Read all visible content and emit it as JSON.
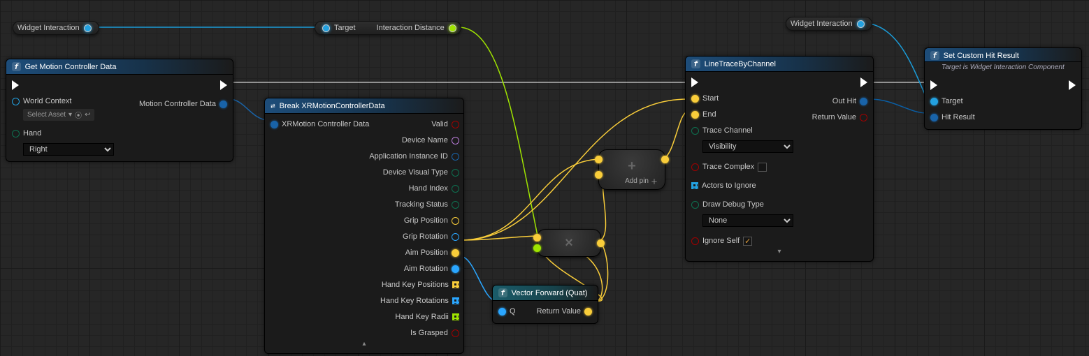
{
  "chips": {
    "widget_interaction_a": "Widget Interaction",
    "widget_interaction_b": "Widget Interaction",
    "target": "Target",
    "interaction_distance": "Interaction Distance"
  },
  "n_gmcd": {
    "title": "Get Motion Controller Data",
    "in": {
      "world_context": "World Context",
      "select_asset": "Select Asset",
      "hand": "Hand",
      "hand_value": "Right"
    },
    "out": {
      "mcd": "Motion Controller Data"
    }
  },
  "n_break": {
    "title": "Break XRMotionControllerData",
    "in": "XRMotion Controller Data",
    "out": {
      "valid": "Valid",
      "device_name": "Device Name",
      "app_id": "Application Instance ID",
      "device_visual": "Device Visual Type",
      "hand_index": "Hand Index",
      "tracking": "Tracking Status",
      "grip_pos": "Grip Position",
      "grip_rot": "Grip Rotation",
      "aim_pos": "Aim Position",
      "aim_rot": "Aim Rotation",
      "hk_pos": "Hand Key Positions",
      "hk_rot": "Hand Key Rotations",
      "hk_radii": "Hand Key Radii",
      "is_grasped": "Is Grasped"
    }
  },
  "n_vfq": {
    "title": "Vector Forward (Quat)",
    "in": "Q",
    "out": "Return Value"
  },
  "n_addpin": "Add pin",
  "n_trace": {
    "title": "LineTraceByChannel",
    "in": {
      "start": "Start",
      "end": "End",
      "trace_channel": "Trace Channel",
      "tc_value": "Visibility",
      "trace_complex": "Trace Complex",
      "actors": "Actors to Ignore",
      "draw": "Draw Debug Type",
      "draw_value": "None",
      "ignore": "Ignore Self"
    },
    "out": {
      "out_hit": "Out Hit",
      "return": "Return Value"
    }
  },
  "n_sethit": {
    "title": "Set Custom Hit Result",
    "sub": "Target is Widget Interaction Component",
    "in": {
      "target": "Target",
      "hit": "Hit Result"
    }
  }
}
